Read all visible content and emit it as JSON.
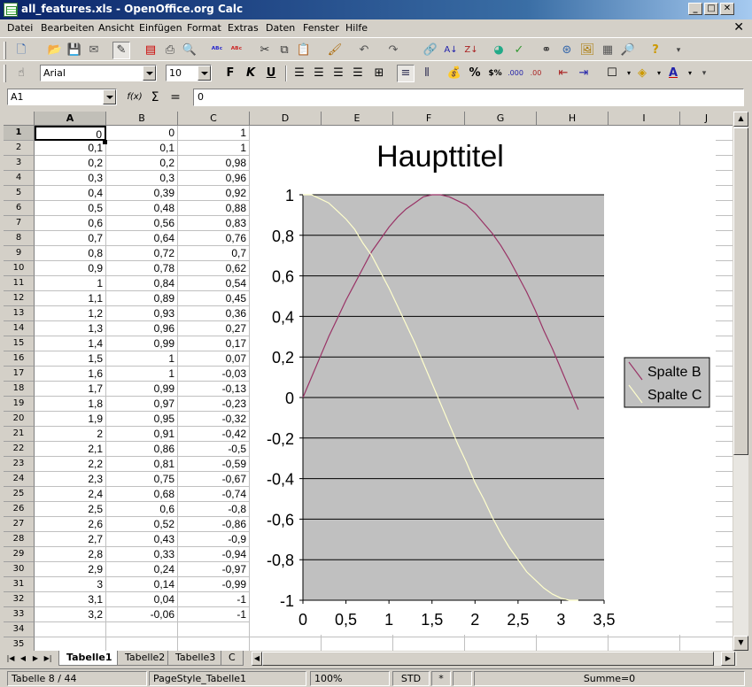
{
  "window": {
    "title": "all_features.xls - OpenOffice.org Calc",
    "minimize": "_",
    "maximize": "□",
    "close": "✕"
  },
  "menu": [
    "Datei",
    "Bearbeiten",
    "Ansicht",
    "Einfügen",
    "Format",
    "Extras",
    "Daten",
    "Fenster",
    "Hilfe"
  ],
  "format_toolbar": {
    "font_name": "Arial",
    "font_size": "10",
    "bold": "F",
    "italic": "K",
    "underline": "U"
  },
  "formula": {
    "cell_ref": "A1",
    "fx": "f(x)",
    "sum": "Σ",
    "equals": "=",
    "content": "0"
  },
  "columns": [
    "A",
    "B",
    "C",
    "D",
    "E",
    "F",
    "G",
    "H",
    "I",
    "J"
  ],
  "rows": [
    [
      "0",
      "0",
      "1"
    ],
    [
      "0,1",
      "0,1",
      "1"
    ],
    [
      "0,2",
      "0,2",
      "0,98"
    ],
    [
      "0,3",
      "0,3",
      "0,96"
    ],
    [
      "0,4",
      "0,39",
      "0,92"
    ],
    [
      "0,5",
      "0,48",
      "0,88"
    ],
    [
      "0,6",
      "0,56",
      "0,83"
    ],
    [
      "0,7",
      "0,64",
      "0,76"
    ],
    [
      "0,8",
      "0,72",
      "0,7"
    ],
    [
      "0,9",
      "0,78",
      "0,62"
    ],
    [
      "1",
      "0,84",
      "0,54"
    ],
    [
      "1,1",
      "0,89",
      "0,45"
    ],
    [
      "1,2",
      "0,93",
      "0,36"
    ],
    [
      "1,3",
      "0,96",
      "0,27"
    ],
    [
      "1,4",
      "0,99",
      "0,17"
    ],
    [
      "1,5",
      "1",
      "0,07"
    ],
    [
      "1,6",
      "1",
      "-0,03"
    ],
    [
      "1,7",
      "0,99",
      "-0,13"
    ],
    [
      "1,8",
      "0,97",
      "-0,23"
    ],
    [
      "1,9",
      "0,95",
      "-0,32"
    ],
    [
      "2",
      "0,91",
      "-0,42"
    ],
    [
      "2,1",
      "0,86",
      "-0,5"
    ],
    [
      "2,2",
      "0,81",
      "-0,59"
    ],
    [
      "2,3",
      "0,75",
      "-0,67"
    ],
    [
      "2,4",
      "0,68",
      "-0,74"
    ],
    [
      "2,5",
      "0,6",
      "-0,8"
    ],
    [
      "2,6",
      "0,52",
      "-0,86"
    ],
    [
      "2,7",
      "0,43",
      "-0,9"
    ],
    [
      "2,8",
      "0,33",
      "-0,94"
    ],
    [
      "2,9",
      "0,24",
      "-0,97"
    ],
    [
      "3",
      "0,14",
      "-0,99"
    ],
    [
      "3,1",
      "0,04",
      "-1"
    ],
    [
      "3,2",
      "-0,06",
      "-1"
    ],
    [
      "",
      "",
      ""
    ],
    [
      "",
      "",
      ""
    ]
  ],
  "chart_data": {
    "type": "line",
    "title": "Haupttitel",
    "xlim": [
      0,
      3.5
    ],
    "ylim": [
      -1,
      1
    ],
    "xticks": [
      0,
      0.5,
      1,
      1.5,
      2,
      2.5,
      3,
      3.5
    ],
    "yticks": [
      1,
      0.8,
      0.6,
      0.4,
      0.2,
      0,
      -0.2,
      -0.4,
      -0.6,
      -0.8,
      -1
    ],
    "grid": true,
    "legend_position": "right",
    "x": [
      0,
      0.1,
      0.2,
      0.3,
      0.4,
      0.5,
      0.6,
      0.7,
      0.8,
      0.9,
      1,
      1.1,
      1.2,
      1.3,
      1.4,
      1.5,
      1.6,
      1.7,
      1.8,
      1.9,
      2,
      2.1,
      2.2,
      2.3,
      2.4,
      2.5,
      2.6,
      2.7,
      2.8,
      2.9,
      3,
      3.1,
      3.2
    ],
    "series": [
      {
        "name": "Spalte B",
        "color": "#993366",
        "values": [
          0,
          0.1,
          0.2,
          0.3,
          0.39,
          0.48,
          0.56,
          0.64,
          0.72,
          0.78,
          0.84,
          0.89,
          0.93,
          0.96,
          0.99,
          1,
          1,
          0.99,
          0.97,
          0.95,
          0.91,
          0.86,
          0.81,
          0.75,
          0.68,
          0.6,
          0.52,
          0.43,
          0.33,
          0.24,
          0.14,
          0.04,
          -0.06
        ]
      },
      {
        "name": "Spalte C",
        "color": "#ffffcc",
        "values": [
          1,
          1,
          0.98,
          0.96,
          0.92,
          0.88,
          0.83,
          0.76,
          0.7,
          0.62,
          0.54,
          0.45,
          0.36,
          0.27,
          0.17,
          0.07,
          -0.03,
          -0.13,
          -0.23,
          -0.32,
          -0.42,
          -0.5,
          -0.59,
          -0.67,
          -0.74,
          -0.8,
          -0.86,
          -0.9,
          -0.94,
          -0.97,
          -0.99,
          -1,
          -1
        ]
      }
    ],
    "plot_background": "#c0c0c0"
  },
  "tabs": {
    "items": [
      "Tabelle1",
      "Tabelle2",
      "Tabelle3",
      "C"
    ],
    "active": 0
  },
  "status": {
    "sheet": "Tabelle 8 / 44",
    "page_style": "PageStyle_Tabelle1",
    "zoom": "100%",
    "mode": "STD",
    "modified": "*",
    "sum": "Summe=0"
  }
}
